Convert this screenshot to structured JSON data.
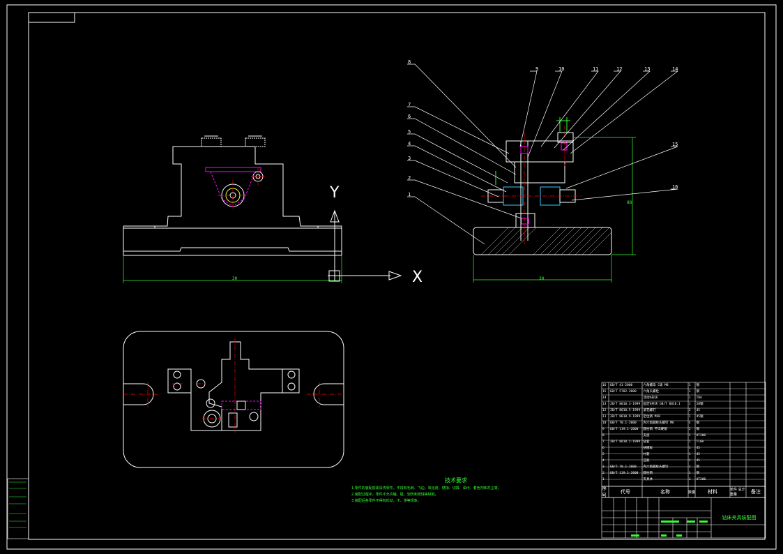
{
  "axes": {
    "y": "Y",
    "x": "X"
  },
  "dimensions": {
    "front_width": "30",
    "side_width": "30",
    "side_height": "88"
  },
  "balloons": [
    "1",
    "2",
    "3",
    "4",
    "5",
    "6",
    "7",
    "8",
    "9",
    "10",
    "11",
    "12",
    "13",
    "14",
    "15",
    "16"
  ],
  "notes": {
    "title": "技术要求",
    "items": [
      "1.零件的装配前需清洗零件，不得有毛刺、飞边、氧化皮、锈蚀、切屑、油污、着色剂和灰尘等。",
      "2.装配过程中，零件不允许磕、碰、划伤和锈蚀等缺陷。",
      "3.装配后各零件不得有松动、卡、滞等现象。"
    ]
  },
  "bom": {
    "header": {
      "no": "序号",
      "code": "代号",
      "name": "名称",
      "qty": "数量",
      "material": "材料",
      "weight": "单件 总计 重量",
      "note": "备注"
    },
    "rows": [
      {
        "no": "16",
        "code": "GB/T 41-2000",
        "name": "六角螺母 C级 M8",
        "qty": "1",
        "material": "钢",
        "note": ""
      },
      {
        "no": "15",
        "code": "GB/T 5782-2000",
        "name": "六角头螺栓",
        "qty": "1",
        "material": "钢",
        "note": ""
      },
      {
        "no": "14",
        "code": "",
        "name": "活动V形块",
        "qty": "1",
        "material": "T8A",
        "note": ""
      },
      {
        "no": "13",
        "code": "JB/T 8010.3-1999",
        "name": "固定V形块 GB/T 8018.1",
        "qty": "1",
        "material": "20钢",
        "note": ""
      },
      {
        "no": "12",
        "code": "JB/T 8010.5-1999",
        "name": "滚花螺钉",
        "qty": "2",
        "material": "45",
        "note": ""
      },
      {
        "no": "11",
        "code": "JB/T 8010.9-1999",
        "name": "定位销 M10",
        "qty": "1",
        "material": "45钢",
        "note": ""
      },
      {
        "no": "10",
        "code": "GB/T 70.1-2000",
        "name": "内六角圆柱头螺钉 M6",
        "qty": "4",
        "material": "钢",
        "note": ""
      },
      {
        "no": "9",
        "code": "GB/T 119.1-2000",
        "name": "圆柱销 不淬硬钢",
        "qty": "2",
        "material": "钢",
        "note": ""
      },
      {
        "no": "8",
        "code": "",
        "name": "支座",
        "qty": "1",
        "material": "HT200",
        "note": ""
      },
      {
        "no": "7",
        "code": "JB/T 8010.2-1999",
        "name": "钻套",
        "qty": "1",
        "material": "T10A",
        "note": ""
      },
      {
        "no": "6",
        "code": "",
        "name": "钻模板",
        "qty": "1",
        "material": "45",
        "note": ""
      },
      {
        "no": "5",
        "code": "",
        "name": "衬套",
        "qty": "1",
        "material": "45",
        "note": ""
      },
      {
        "no": "4",
        "code": "",
        "name": "压板",
        "qty": "1",
        "material": "45",
        "note": ""
      },
      {
        "no": "3",
        "code": "GB/T 70.1-2000",
        "name": "内六角圆柱头螺钉",
        "qty": "1",
        "material": "钢",
        "note": ""
      },
      {
        "no": "2",
        "code": "GB/T 119.1-2000",
        "name": "圆柱销",
        "qty": "1",
        "material": "钢",
        "note": ""
      },
      {
        "no": "1",
        "code": "",
        "name": "夹具体",
        "qty": "1",
        "material": "HT200",
        "note": ""
      }
    ]
  },
  "title_block": {
    "drawing_name": "钻床夹具装配图"
  }
}
